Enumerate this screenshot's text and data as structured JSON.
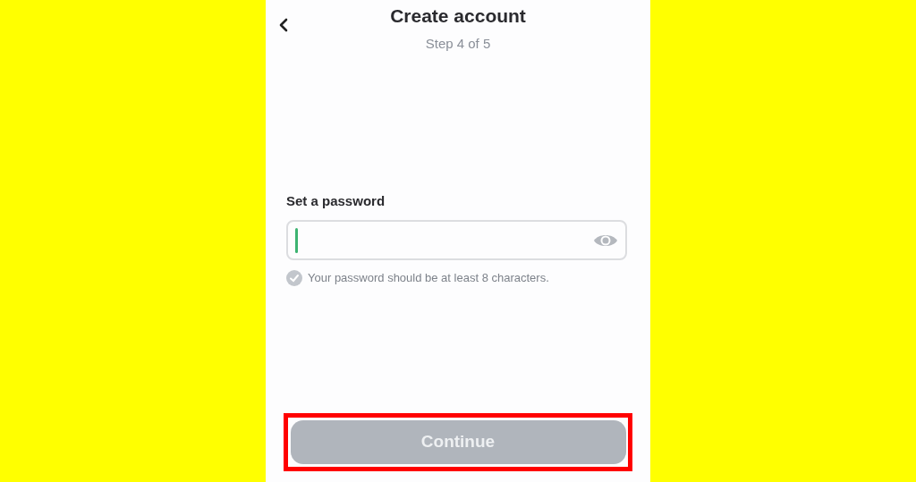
{
  "header": {
    "title": "Create account",
    "step": "Step 4 of 5"
  },
  "password": {
    "label": "Set a password",
    "focused": true
  },
  "requirement": {
    "text": "Your password should be at least 8 characters.",
    "met": false
  },
  "continue_button": {
    "label": "Continue",
    "disabled": true,
    "highlighted": true
  }
}
